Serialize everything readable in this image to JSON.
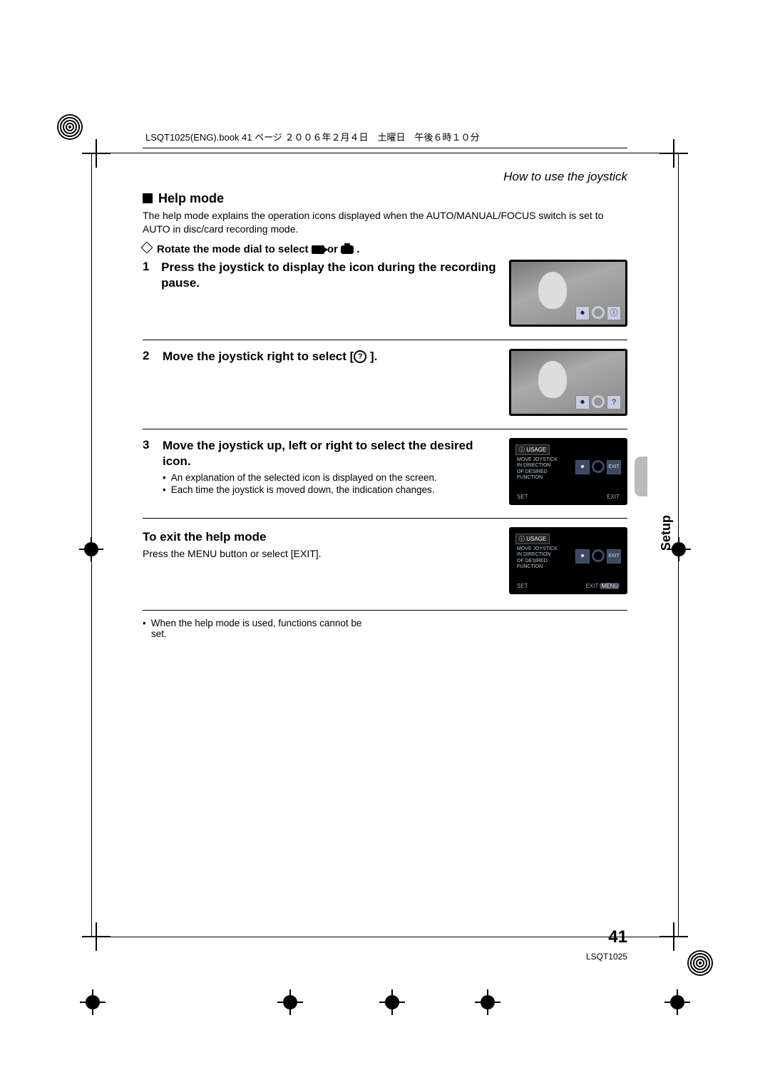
{
  "source_line": "LSQT1025(ENG).book  41 ページ  ２００６年２月４日　土曜日　午後６時１０分",
  "breadcrumb": "How to use the joystick",
  "section_title": "Help mode",
  "intro": "The help mode explains the operation icons displayed when the AUTO/MANUAL/FOCUS switch is set to AUTO in disc/card recording mode.",
  "pre_instruction_a": "Rotate the mode dial to select ",
  "pre_instruction_b": " or ",
  "pre_instruction_c": " .",
  "steps": [
    {
      "num": "1",
      "title": "Press the joystick to display the icon during the recording pause."
    },
    {
      "num": "2",
      "title_a": "Move the joystick right to select [",
      "title_b": " ]."
    },
    {
      "num": "3",
      "title": "Move the joystick up, left or right to select the desired icon.",
      "bullets": [
        "An explanation of the selected icon is displayed on the screen.",
        "Each time the joystick is moved down, the indication changes."
      ]
    }
  ],
  "exit_title": "To exit the help mode",
  "exit_body": "Press the MENU button or select [EXIT].",
  "note": "When the help mode is used, functions cannot be set.",
  "side_label": "Setup",
  "page_number": "41",
  "doc_id": "LSQT1025",
  "usage_panel": {
    "header": "USAGE",
    "lines": "MOVE JOYSTICK\nIN DIRECTION\nOF DESIRED\nFUNCTION",
    "set": "SET",
    "exit": "EXIT",
    "exit2_btn": "MENU"
  },
  "thumb_icons": {
    "rec": "⏺",
    "info": "ⓘ",
    "help": "?",
    "exit": "EXIT"
  }
}
